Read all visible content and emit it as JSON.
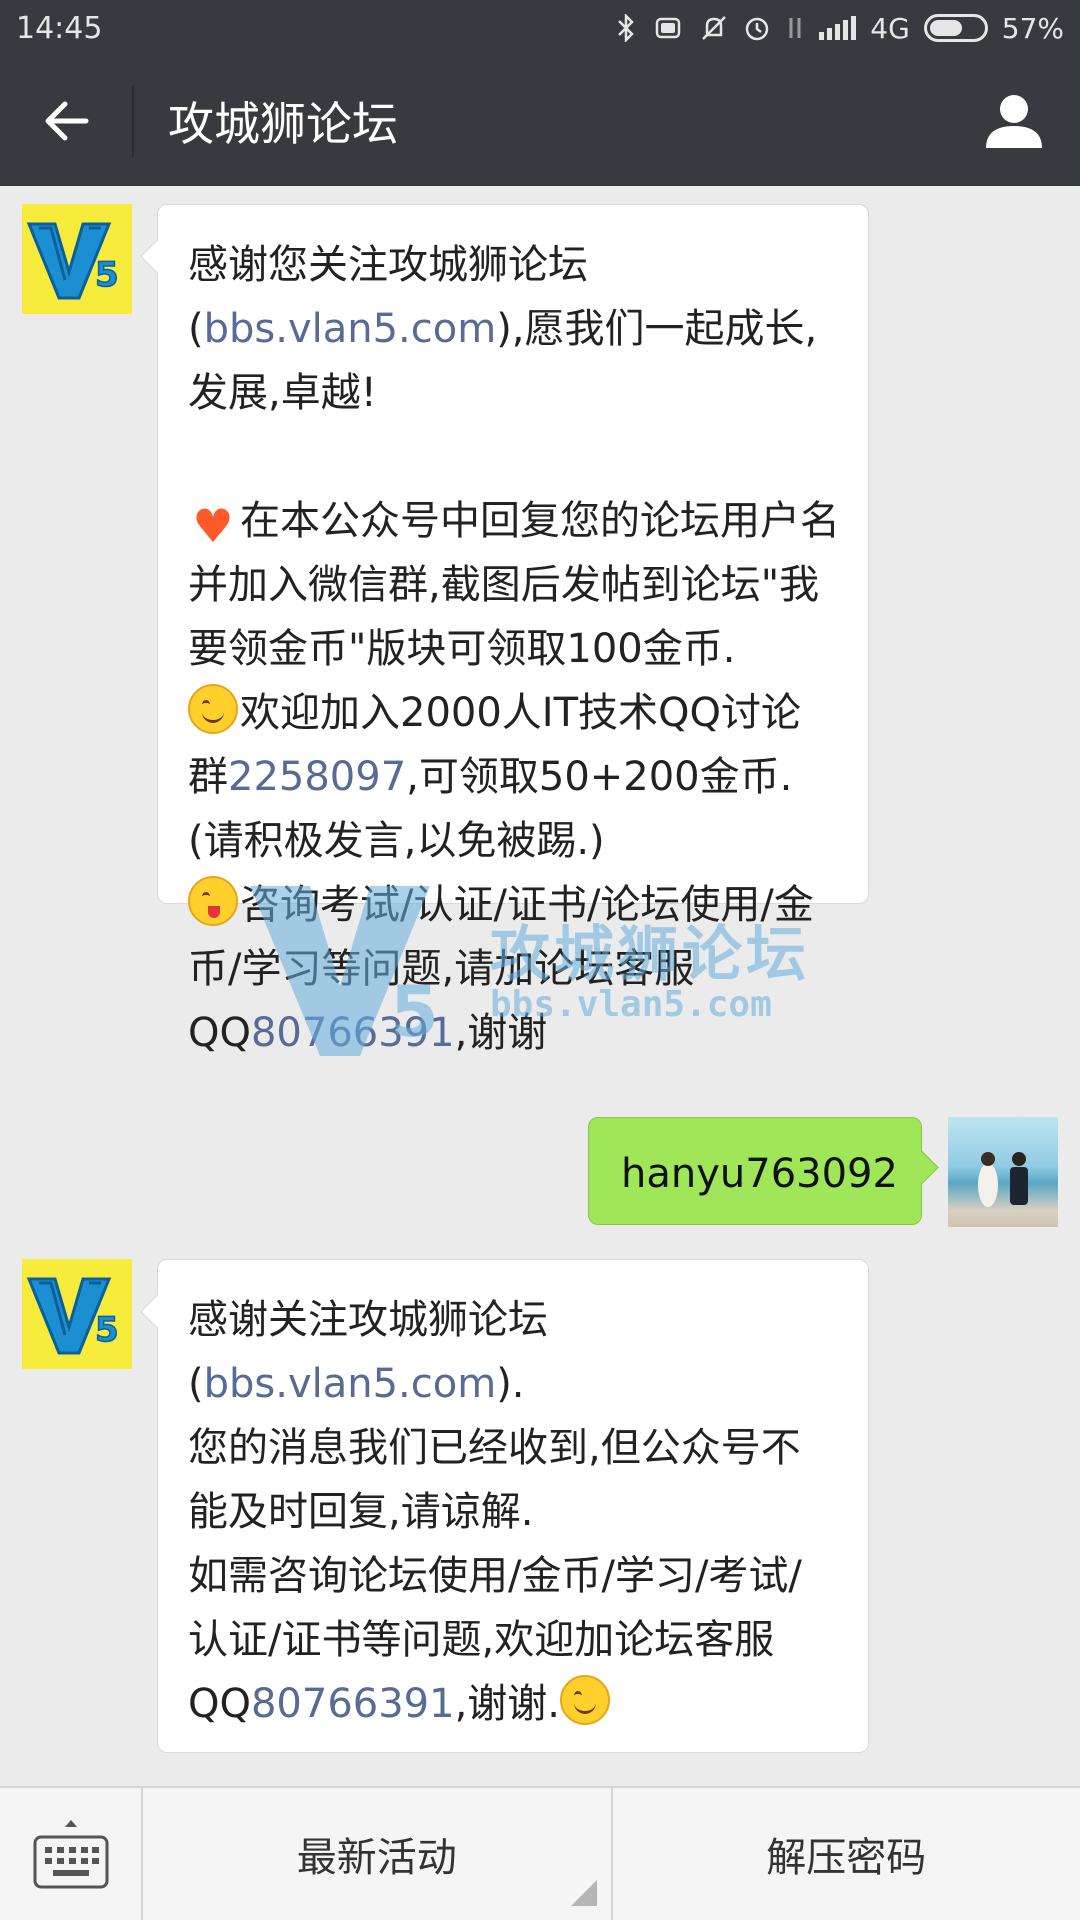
{
  "status_bar": {
    "time": "14:45",
    "network": "4G",
    "battery": "57%"
  },
  "header": {
    "title": "攻城狮论坛",
    "back_icon": "back-arrow-icon",
    "profile_icon": "person-icon"
  },
  "messages": [
    {
      "side": "left",
      "avatar": "V5",
      "lines": {
        "p1_a": "感谢您关注攻城狮论坛(",
        "p1_link": "bbs.vlan5.com",
        "p1_b": "),愿我们一起成长,发展,卓越!",
        "p2": "在本公众号中回复您的论坛用户名并加入微信群,截图后发帖到论坛\"我要领金币\"版块可领取100金币.",
        "p3_a": "欢迎加入2000人IT技术QQ讨论群",
        "p3_link": "2258097",
        "p3_b": ",可领取50+200金币.(请积极发言,以免被踢.)",
        "p4_a": "咨询考试/认证/证书/论坛使用/金币/学习等问题,请加论坛客服QQ",
        "p4_link": "80766391",
        "p4_b": ",谢谢"
      },
      "watermark": {
        "logo": "V5",
        "title": "攻城狮论坛",
        "url": "bbs.vlan5.com"
      }
    },
    {
      "side": "right",
      "text": "hanyu763092"
    },
    {
      "side": "left",
      "avatar": "V5",
      "lines": {
        "p1_a": "感谢关注攻城狮论坛(",
        "p1_link": "bbs.vlan5.com",
        "p1_b": ").",
        "p2": "您的消息我们已经收到,但公众号不能及时回复,请谅解.",
        "p3_a": "如需咨询论坛使用/金币/学习/考试/认证/证书等问题,欢迎加论坛客服QQ",
        "p3_link": "80766391",
        "p3_b": ",谢谢."
      }
    }
  ],
  "bottom_menu": {
    "keyboard_icon": "keyboard-icon",
    "items": [
      "最新活动",
      "解压密码"
    ]
  },
  "colors": {
    "header_bg": "#393a3f",
    "chat_bg": "#ebebeb",
    "sent_bubble": "#9fe658",
    "link": "#576b95",
    "avatar_bg": "#f7ec3c"
  }
}
